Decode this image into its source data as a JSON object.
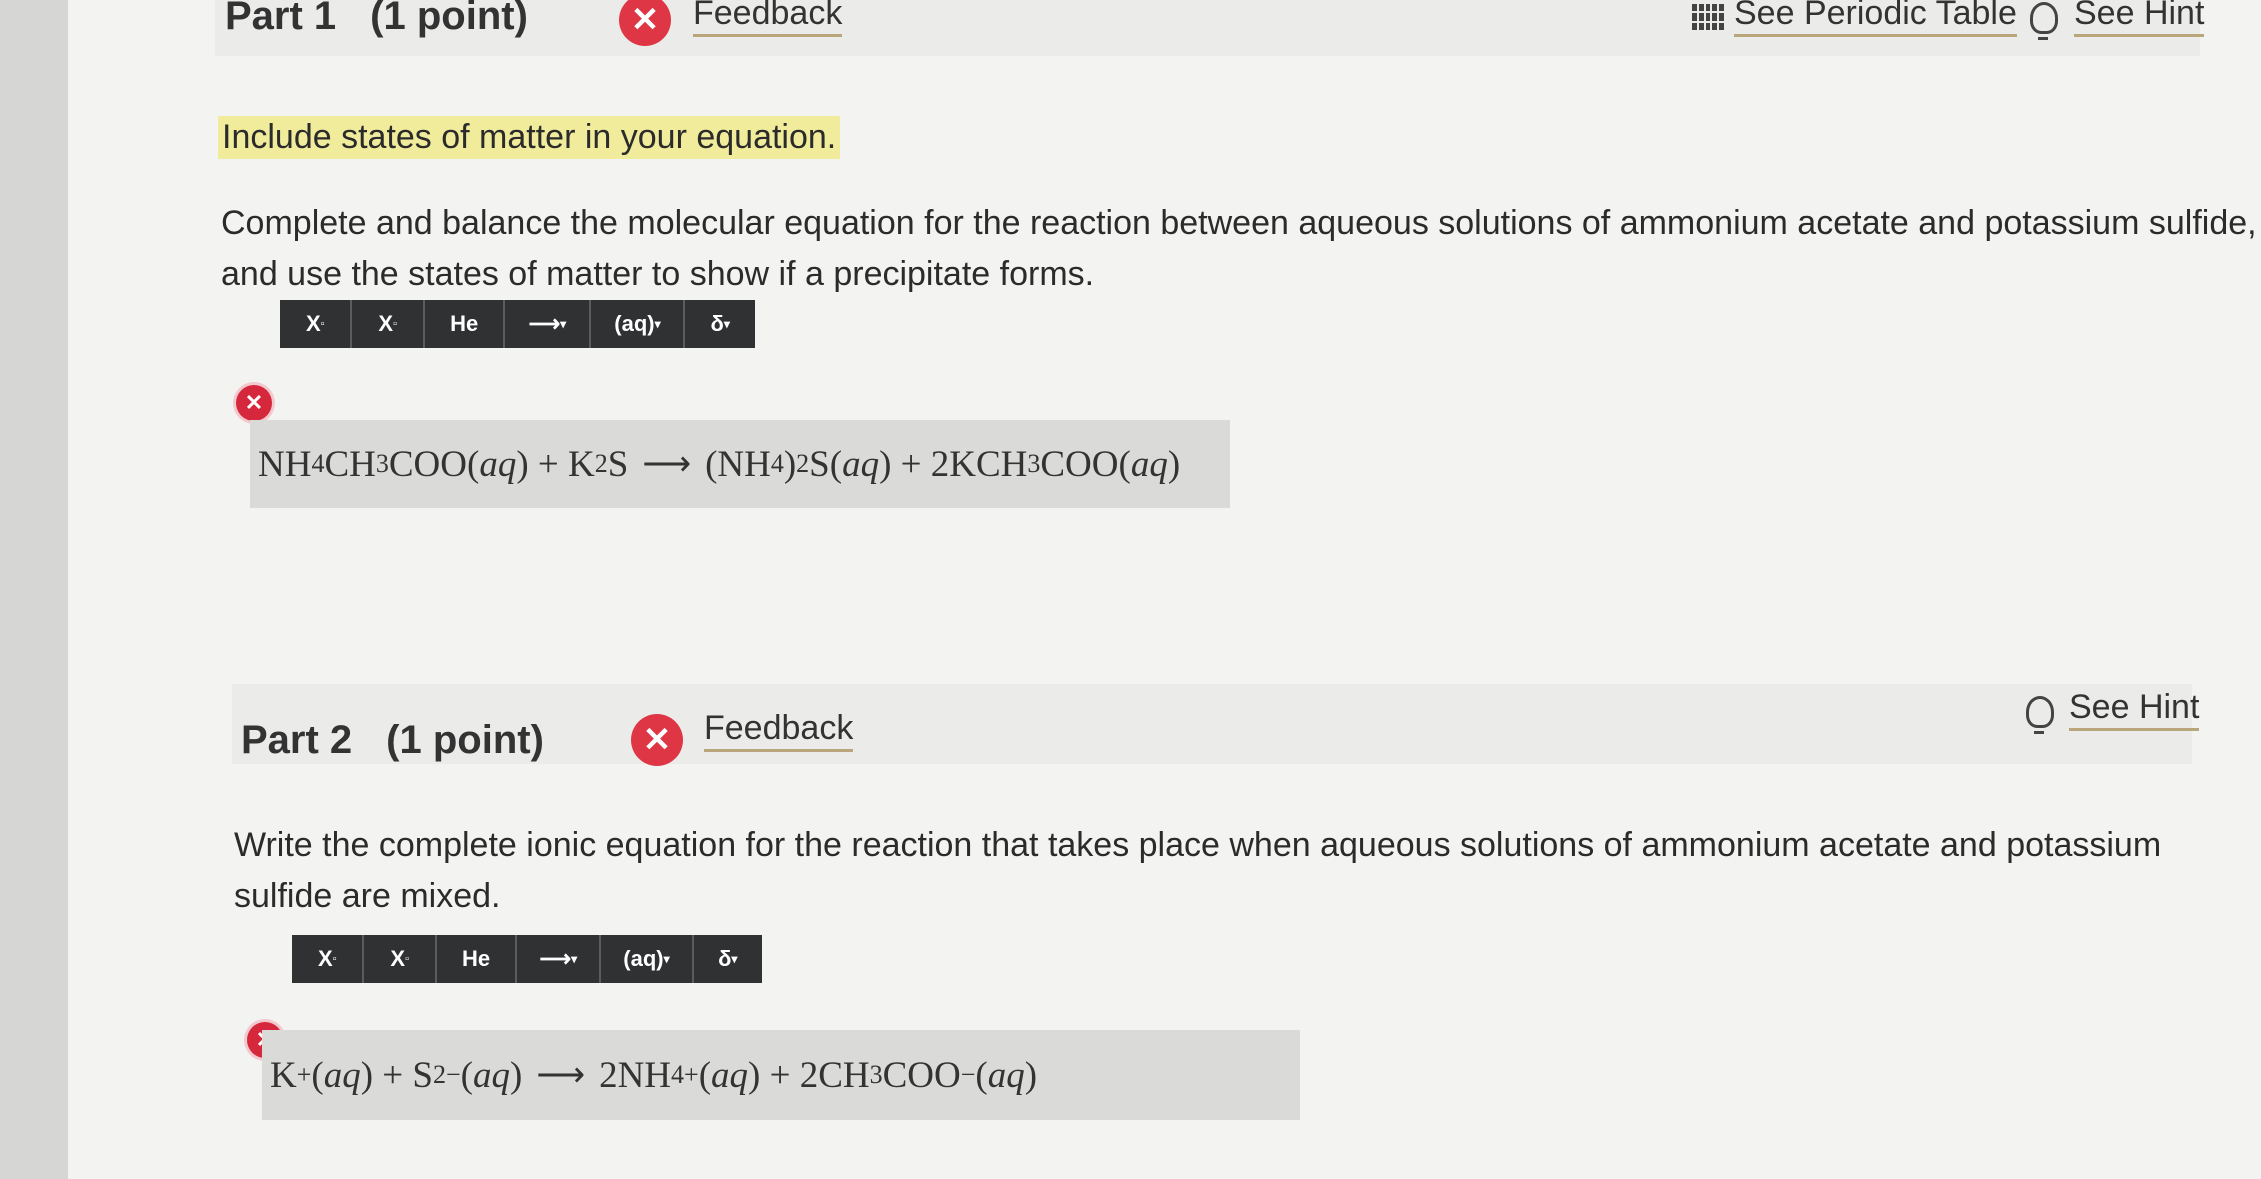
{
  "part1": {
    "title": "Part 1",
    "points": "(1 point)",
    "feedback_label": "Feedback",
    "periodic_table_label": "See Periodic Table",
    "hint_label": "See Hint",
    "instruction": "Include states of matter in your equation.",
    "prompt_line1": "Complete and balance the molecular equation for the reaction between aqueous solutions of ammonium acetate and potassium sulfide,",
    "prompt_line2": "and use the states of matter to show if a precipitate forms.",
    "answer_status": "incorrect"
  },
  "part2": {
    "title": "Part 2",
    "points": "(1 point)",
    "feedback_label": "Feedback",
    "hint_label": "See Hint",
    "prompt_line1": "Write the complete ionic equation for the reaction that takes place when aqueous solutions of ammonium acetate and potassium",
    "prompt_line2": "sulfide are mixed.",
    "answer_status": "incorrect"
  },
  "toolbar": {
    "superscript": "X",
    "subscript": "X",
    "element": "He",
    "arrow": "⟶",
    "state": "(aq)",
    "delta": "δ"
  },
  "colors": {
    "error_red": "#df3645",
    "highlight": "#f1ec9b",
    "toolbar_bg": "#2f3133"
  },
  "icons": [
    "close-icon",
    "periodic-table-icon",
    "lightbulb-icon",
    "error-icon"
  ]
}
